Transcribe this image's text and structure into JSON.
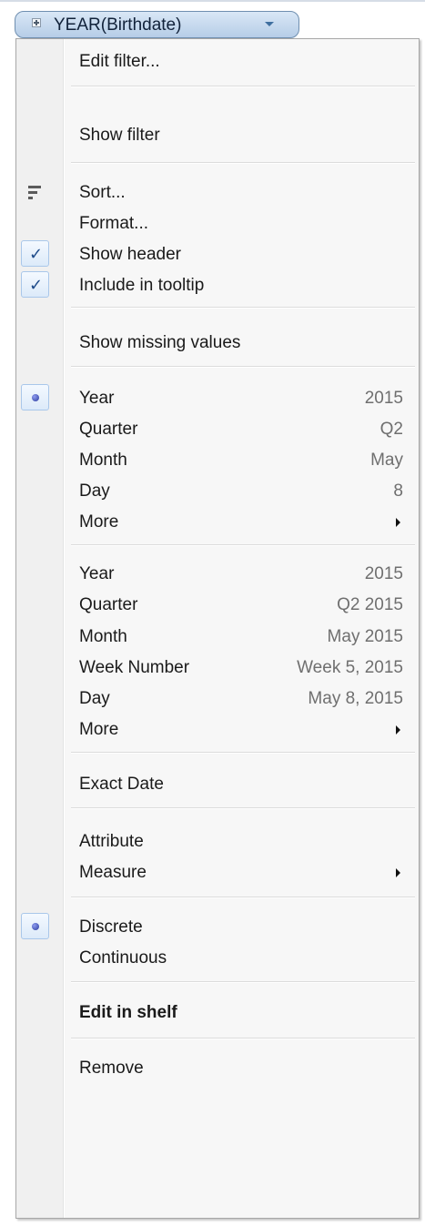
{
  "pill": {
    "label": "YEAR(Birthdate)",
    "expand_icon": "plus-box-icon",
    "dropdown_icon": "chevron-down-icon"
  },
  "menu": {
    "edit_filter": "Edit filter...",
    "show_filter": "Show filter",
    "sort": "Sort...",
    "format": "Format...",
    "show_header": "Show header",
    "include_in_tooltip": "Include in tooltip",
    "show_missing_values": "Show missing values",
    "date_parts": [
      {
        "label": "Year",
        "value": "2015",
        "selected": true
      },
      {
        "label": "Quarter",
        "value": "Q2"
      },
      {
        "label": "Month",
        "value": "May"
      },
      {
        "label": "Day",
        "value": "8"
      },
      {
        "label": "More",
        "submenu": true
      }
    ],
    "date_values": [
      {
        "label": "Year",
        "value": "2015"
      },
      {
        "label": "Quarter",
        "value": "Q2 2015"
      },
      {
        "label": "Month",
        "value": "May 2015"
      },
      {
        "label": "Week Number",
        "value": "Week 5, 2015"
      },
      {
        "label": "Day",
        "value": "May 8, 2015"
      },
      {
        "label": "More",
        "submenu": true
      }
    ],
    "exact_date": "Exact Date",
    "attribute": "Attribute",
    "measure": "Measure",
    "discrete": "Discrete",
    "continuous": "Continuous",
    "edit_in_shelf": "Edit in shelf",
    "remove": "Remove"
  },
  "icons": {
    "sort": "sort-icon",
    "check": "checkmark-icon",
    "radio": "radio-dot-icon",
    "submenu": "submenu-arrow-icon"
  },
  "colors": {
    "pill_fill": "#c7daef",
    "pill_border": "#6f8fb0",
    "menu_bg": "#f7f7f7",
    "check": "#1e4b8a",
    "value_text": "#6f6f6f"
  }
}
